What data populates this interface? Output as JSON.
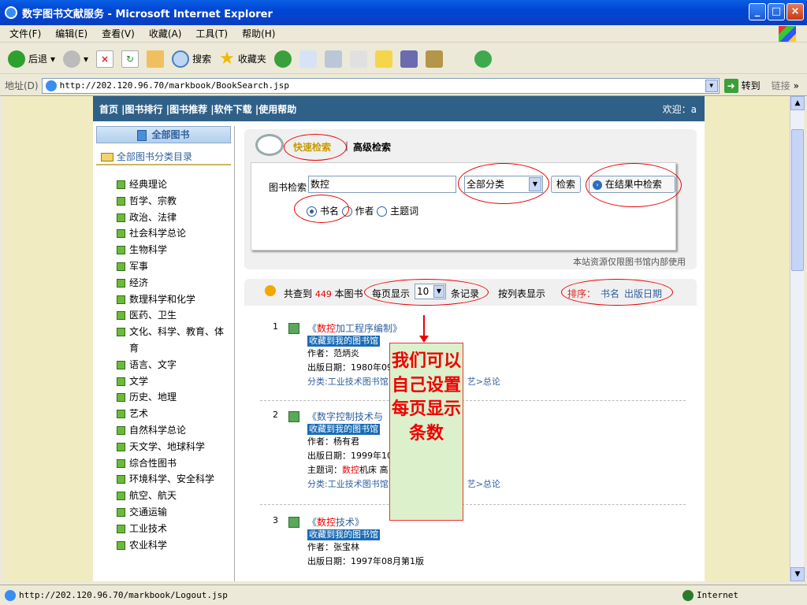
{
  "window": {
    "title": "数字图书文献服务 - Microsoft Internet Explorer"
  },
  "menu": [
    "文件(F)",
    "编辑(E)",
    "查看(V)",
    "收藏(A)",
    "工具(T)",
    "帮助(H)"
  ],
  "toolbar": {
    "back": "后退",
    "search": "搜索",
    "favorites": "收藏夹"
  },
  "address": {
    "label": "地址(D)",
    "url": "http://202.120.96.70/markbook/BookSearch.jsp",
    "go": "转到",
    "links": "链接"
  },
  "site": {
    "nav": "首页 |图书排行 |图书推荐 |软件下载 |使用帮助",
    "welcome": "欢迎：a"
  },
  "sidebar": {
    "all_books": "全部图书",
    "catalog": "全部图书分类目录",
    "categories": [
      "经典理论",
      "哲学、宗教",
      "政治、法律",
      "社会科学总论",
      "生物科学",
      "军事",
      "经济",
      "数理科学和化学",
      "医药、卫生",
      "文化、科学、教育、体育",
      "语言、文字",
      "文学",
      "历史、地理",
      "艺术",
      "自然科学总论",
      "天文学、地球科学",
      "综合性图书",
      "环境科学、安全科学",
      "航空、航天",
      "交通运输",
      "工业技术",
      "农业科学"
    ]
  },
  "search": {
    "tab_quick": "快速检索",
    "tab_advanced": "高级检索",
    "label": "图书检索",
    "query": "数控",
    "category": "全部分类",
    "search_btn": "检索",
    "in_result_btn": "在结果中检索",
    "radio_title": "书名",
    "radio_author": "作者",
    "radio_subject": "主题词",
    "notice": "本站资源仅限图书馆内部使用"
  },
  "results": {
    "found_prefix": "共查到",
    "found_count": "449",
    "found_suffix": "本图书",
    "per_page_label": "每页显示",
    "per_page": "10",
    "per_page_suffix": "条记录",
    "list_view": "按列表显示",
    "sort_label": "排序：",
    "sort_title": "书名",
    "sort_date": "出版日期",
    "collect": "收藏到我的图书馆",
    "items": [
      {
        "num": "1",
        "title_prefix": "《",
        "title_hl": "数控",
        "title_rest": "加工程序编制》",
        "author": "作者：范炳炎",
        "date": "出版日期：1980年09",
        "category": "分类:工业技术图书馆",
        "category_tail": "艺>总论"
      },
      {
        "num": "2",
        "title_prefix": "《数字控制技术与",
        "author": "作者：杨有君",
        "date": "出版日期：1999年10",
        "subject_label": "主题词：",
        "subject_hl": "数控",
        "subject_rest": "机床 高",
        "category": "分类:工业技术图书馆",
        "category_tail": "艺>总论"
      },
      {
        "num": "3",
        "title_prefix": "《",
        "title_hl": "数控",
        "title_rest": "技术》",
        "author": "作者：张宝林",
        "date": "出版日期：1997年08月第1版"
      }
    ]
  },
  "callout": {
    "text": "我们可以自己设置每页显示条数"
  },
  "status": {
    "url": "http://202.120.96.70/markbook/Logout.jsp",
    "zone": "Internet"
  },
  "colors": {
    "nav_bg": "#2f6088",
    "annotation": "#e00000",
    "callout_bg": "#dcf0cc"
  }
}
